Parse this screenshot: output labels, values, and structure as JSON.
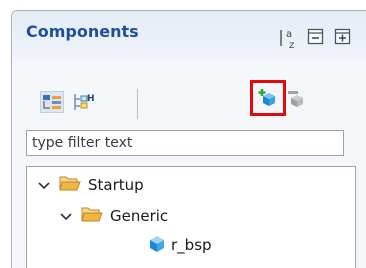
{
  "panel": {
    "title": "Components"
  },
  "view_toolbar": {
    "icons": [
      "sort-alpha-icon",
      "collapse-all-icon",
      "expand-all-icon"
    ],
    "sort_label_top": "a",
    "sort_label_bottom": "z"
  },
  "toolbar": {
    "icons": [
      "show-hierarchy-icon",
      "show-header-icon",
      "add-component-icon",
      "remove-component-icon"
    ],
    "highlight_color": "#e20b0b"
  },
  "filter": {
    "placeholder": "type filter text"
  },
  "tree": {
    "items": [
      {
        "label": "Startup",
        "expanded": true,
        "icon": "folder-open-icon"
      },
      {
        "label": "Generic",
        "expanded": true,
        "icon": "folder-open-icon"
      },
      {
        "label": "r_bsp",
        "icon": "component-cube-icon"
      }
    ]
  },
  "colors": {
    "title": "#1f4e9e",
    "folder": "#f2b640",
    "component": "#2e9ae0"
  }
}
